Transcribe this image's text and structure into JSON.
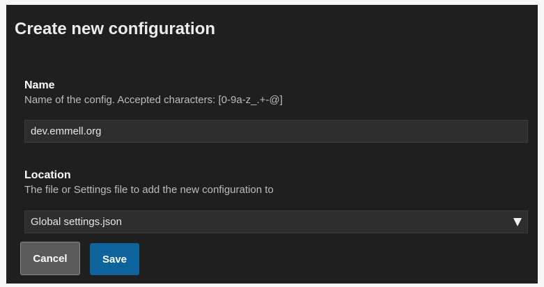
{
  "dialog": {
    "title": "Create new configuration",
    "name_field": {
      "label": "Name",
      "description": "Name of the config. Accepted characters: [0-9a-z_.+-@]",
      "value": "dev.emmell.org"
    },
    "location_field": {
      "label": "Location",
      "description": "The file or Settings file to add the new configuration to",
      "selected": "Global settings.json",
      "dropdown_icon": "chevron-down-icon"
    },
    "buttons": {
      "cancel_label": "Cancel",
      "save_label": "Save"
    }
  },
  "colors": {
    "dialog_bg": "#1f1f1f",
    "input_bg": "#2e2e2e",
    "cancel_bg": "#5b5b5b",
    "save_bg": "#0e639c"
  }
}
